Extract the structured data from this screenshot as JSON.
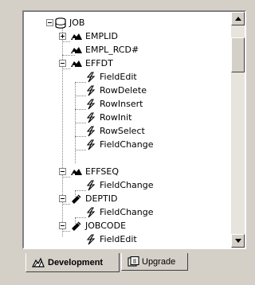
{
  "tree": {
    "nodes": [
      {
        "label": "JOB",
        "icon": "database-icon",
        "toggle": "minus"
      },
      {
        "label": "EMPLID",
        "icon": "key-field-icon",
        "toggle": "plus"
      },
      {
        "label": "EMPL_RCD#",
        "icon": "key-field-icon",
        "toggle": ""
      },
      {
        "label": "EFFDT",
        "icon": "key-field-icon",
        "toggle": "minus"
      },
      {
        "label": "FieldEdit",
        "icon": "lightning-icon",
        "toggle": ""
      },
      {
        "label": "RowDelete",
        "icon": "lightning-icon",
        "toggle": ""
      },
      {
        "label": "RowInsert",
        "icon": "lightning-icon",
        "toggle": ""
      },
      {
        "label": "RowInit",
        "icon": "lightning-icon",
        "toggle": ""
      },
      {
        "label": "RowSelect",
        "icon": "lightning-icon",
        "toggle": ""
      },
      {
        "label": "FieldChange",
        "icon": "lightning-icon",
        "toggle": ""
      },
      {
        "label": "EFFSEQ",
        "icon": "key-field-icon",
        "toggle": "minus"
      },
      {
        "label": "FieldChange",
        "icon": "lightning-icon",
        "toggle": ""
      },
      {
        "label": "DEPTID",
        "icon": "field-icon",
        "toggle": "minus"
      },
      {
        "label": "FieldChange",
        "icon": "lightning-icon",
        "toggle": ""
      },
      {
        "label": "JOBCODE",
        "icon": "field-icon",
        "toggle": "minus"
      },
      {
        "label": "FieldEdit",
        "icon": "lightning-icon",
        "toggle": ""
      }
    ]
  },
  "tabs": [
    {
      "label": "Development",
      "icon": "development-icon",
      "active": true
    },
    {
      "label": "Upgrade",
      "icon": "upgrade-icon",
      "active": false
    }
  ],
  "scrollbar": {
    "up_icon": "arrow-up-icon",
    "down_icon": "arrow-down-icon"
  }
}
